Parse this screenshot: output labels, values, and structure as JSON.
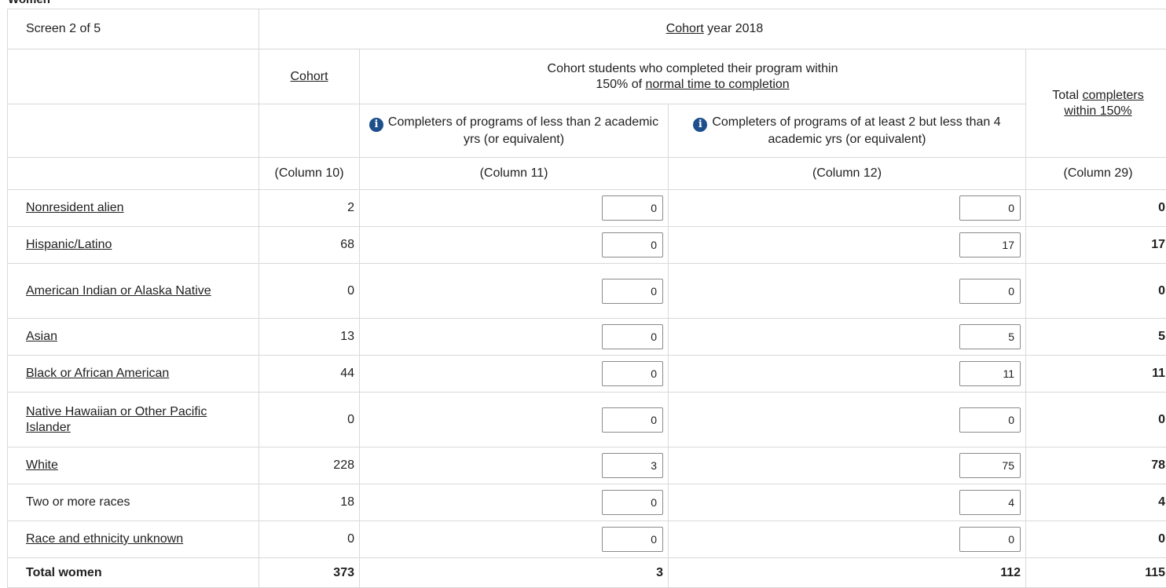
{
  "section_title": "Women",
  "header": {
    "screen": "Screen 2 of 5",
    "cohort_year_link": "Cohort",
    "cohort_year_rest": " year 2018",
    "cohort_col": "Cohort",
    "completed_line1": "Cohort students who completed their program within",
    "completed_line2_prefix": "150% of ",
    "completed_line2_link": "normal time to completion",
    "total_prefix": "Total ",
    "total_link1": "completers",
    "total_link2": "within 150%",
    "sub11": "Completers of programs of less than 2 academic yrs (or equivalent)",
    "sub12": "Completers of programs of at least 2 but less than 4 academic yrs (or equivalent)",
    "col10": "(Column 10)",
    "col11": "(Column 11)",
    "col12": "(Column 12)",
    "col29": "(Column 29)"
  },
  "rows": [
    {
      "label": "Nonresident alien",
      "cohort": "2",
      "c11": "0",
      "c12": "0",
      "total": "0"
    },
    {
      "label": "Hispanic/Latino",
      "cohort": "68",
      "c11": "0",
      "c12": "17",
      "total": "17"
    },
    {
      "label": "American Indian or Alaska Native",
      "cohort": "0",
      "c11": "0",
      "c12": "0",
      "total": "0"
    },
    {
      "label": "Asian",
      "cohort": "13",
      "c11": "0",
      "c12": "5",
      "total": "5"
    },
    {
      "label": "Black or African American",
      "cohort": "44",
      "c11": "0",
      "c12": "11",
      "total": "11"
    },
    {
      "label": "Native Hawaiian or Other Pacific Islander",
      "cohort": "0",
      "c11": "0",
      "c12": "0",
      "total": "0"
    },
    {
      "label": "White",
      "cohort": "228",
      "c11": "3",
      "c12": "75",
      "total": "78"
    },
    {
      "label": "Two or more races",
      "cohort": "18",
      "c11": "0",
      "c12": "4",
      "total": "4"
    },
    {
      "label": "Race and ethnicity unknown",
      "cohort": "0",
      "c11": "0",
      "c12": "0",
      "total": "0"
    }
  ],
  "totals": {
    "label": "Total women",
    "cohort": "373",
    "c11": "3",
    "c12": "112",
    "total": "115"
  },
  "colors": {
    "info_icon": "#1d4f8c",
    "border": "#d9d9d9"
  }
}
